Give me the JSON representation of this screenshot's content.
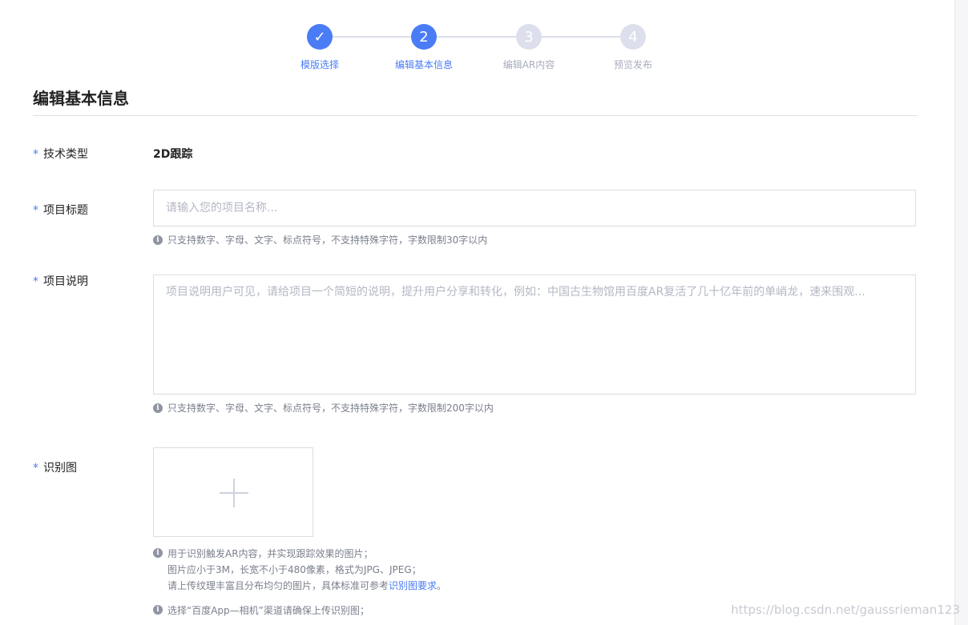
{
  "steps": [
    {
      "label": "模版选择",
      "state": "done",
      "marker": "✓"
    },
    {
      "label": "编辑基本信息",
      "state": "active",
      "marker": "2"
    },
    {
      "label": "编辑AR内容",
      "state": "todo",
      "marker": "3"
    },
    {
      "label": "预览发布",
      "state": "todo",
      "marker": "4"
    }
  ],
  "page_title": "编辑基本信息",
  "form": {
    "required_mark": "*",
    "tech_type": {
      "label": "技术类型",
      "value": "2D跟踪"
    },
    "project_title": {
      "label": "项目标题",
      "placeholder": "请输入您的项目名称...",
      "value": "",
      "hint": "只支持数字、字母、文字、标点符号，不支持特殊字符，字数限制30字以内"
    },
    "project_desc": {
      "label": "项目说明",
      "placeholder": "项目说明用户可见，请给项目一个简短的说明，提升用户分享和转化，例如：中国古生物馆用百度AR复活了几十亿年前的单峭龙，速来围观...",
      "value": "",
      "hint": "只支持数字、字母、文字、标点符号，不支持特殊字符，字数限制200字以内"
    },
    "recognition_image": {
      "label": "识别图",
      "hint_lines": [
        "用于识别触发AR内容，并实现跟踪效果的图片；",
        "图片应小于3M，长宽不小于480像素，格式为JPG、JPEG；",
        "请上传纹理丰富且分布均匀的图片，具体标准可参考"
      ],
      "hint_link": "识别图要求",
      "hint_link_suffix": "。",
      "hint2": "选择“百度App—相机”渠道请确保上传识别图；"
    }
  },
  "info_icon_glyph": "i",
  "watermark": "https://blog.csdn.net/gaussrieman123",
  "colors": {
    "accent": "#4a7cf5",
    "todo": "#dde0ec"
  }
}
